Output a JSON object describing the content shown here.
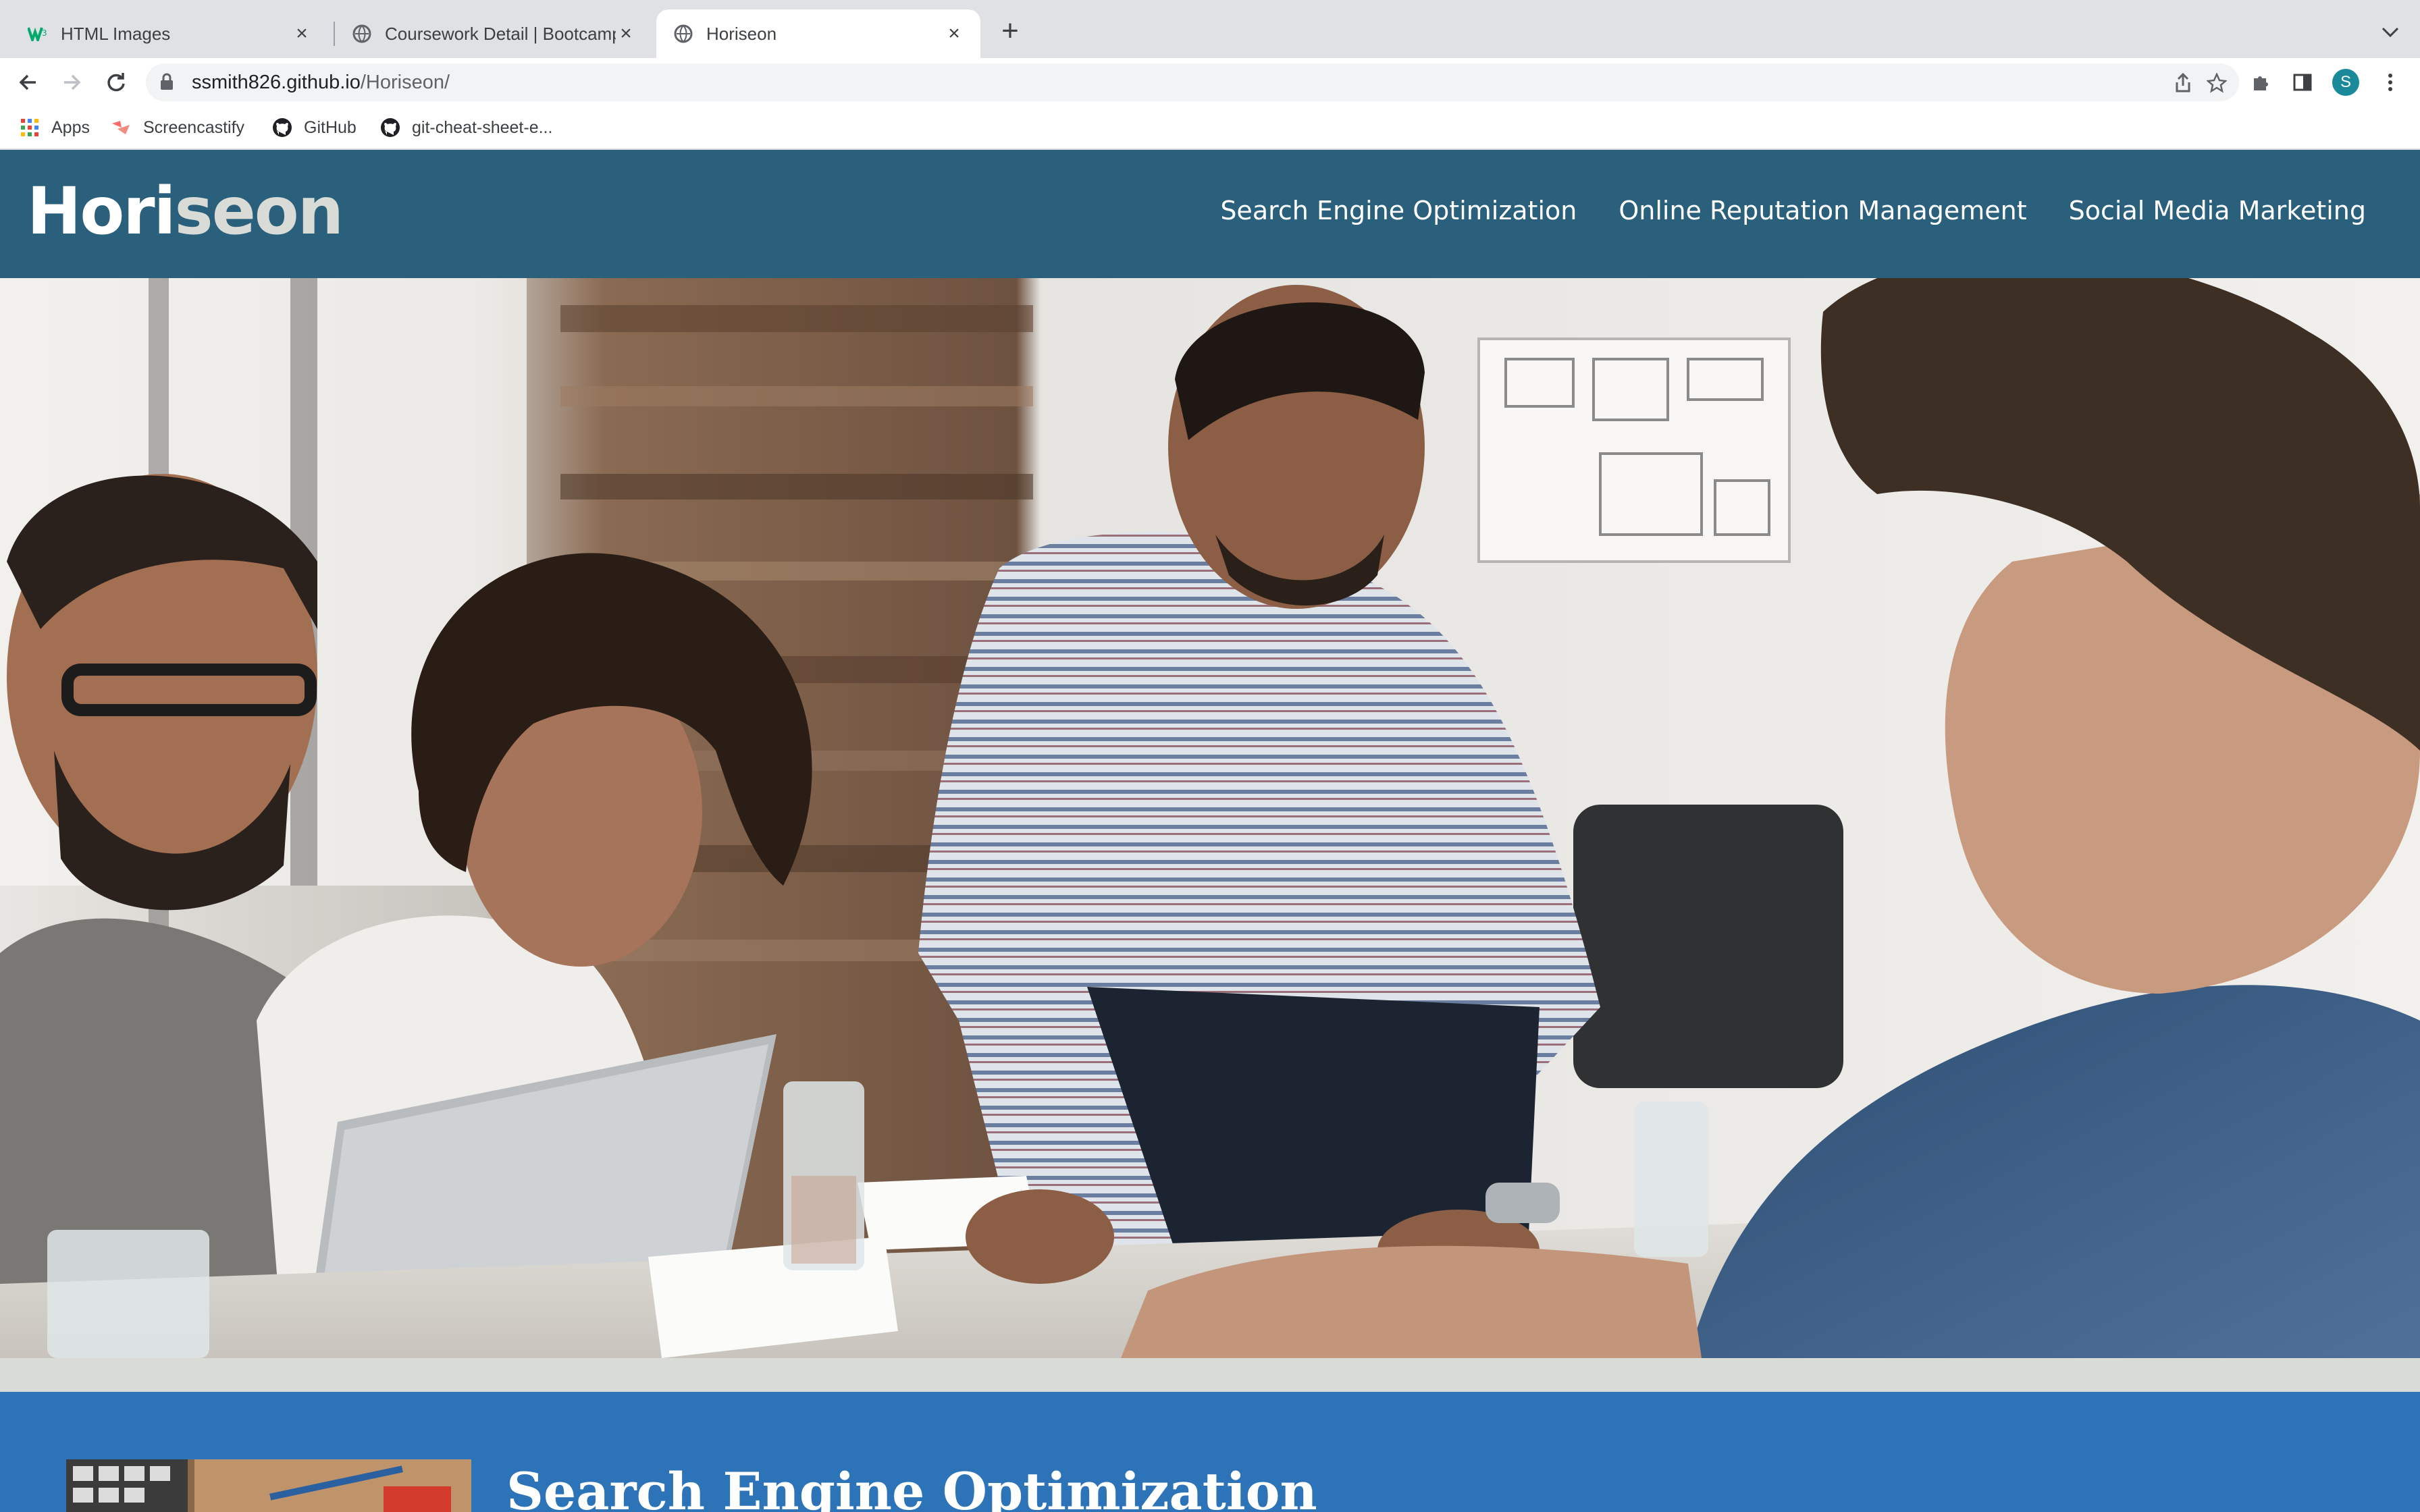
{
  "browser": {
    "tabs": [
      {
        "title": "HTML Images",
        "icon": "w3schools-icon"
      },
      {
        "title": "Coursework Detail | Bootcamp",
        "icon": "globe-icon"
      },
      {
        "title": "Horiseon",
        "icon": "globe-icon",
        "active": true
      }
    ],
    "url_host": "ssmith826.github.io",
    "url_path": "/Horiseon/",
    "profile_initial": "S",
    "bookmarks": [
      {
        "label": "Apps",
        "icon": "apps-grid-icon"
      },
      {
        "label": "Screencastify",
        "icon": "screencastify-icon"
      },
      {
        "label": "GitHub",
        "icon": "github-icon"
      },
      {
        "label": "git-cheat-sheet-e...",
        "icon": "github-icon"
      }
    ]
  },
  "site": {
    "logo_main": "Hori",
    "logo_accent": "seon",
    "nav": [
      "Search Engine Optimization",
      "Online Reputation Management",
      "Social Media Marketing"
    ],
    "hero_image": "team meeting around a table with laptop",
    "section_heading": "Search Engine Optimization"
  },
  "colors": {
    "header_bg": "#2a607c",
    "page_bg": "#d9dcd6",
    "section_bg": "#2c73b7",
    "logo_accent": "#d9dcd6"
  }
}
